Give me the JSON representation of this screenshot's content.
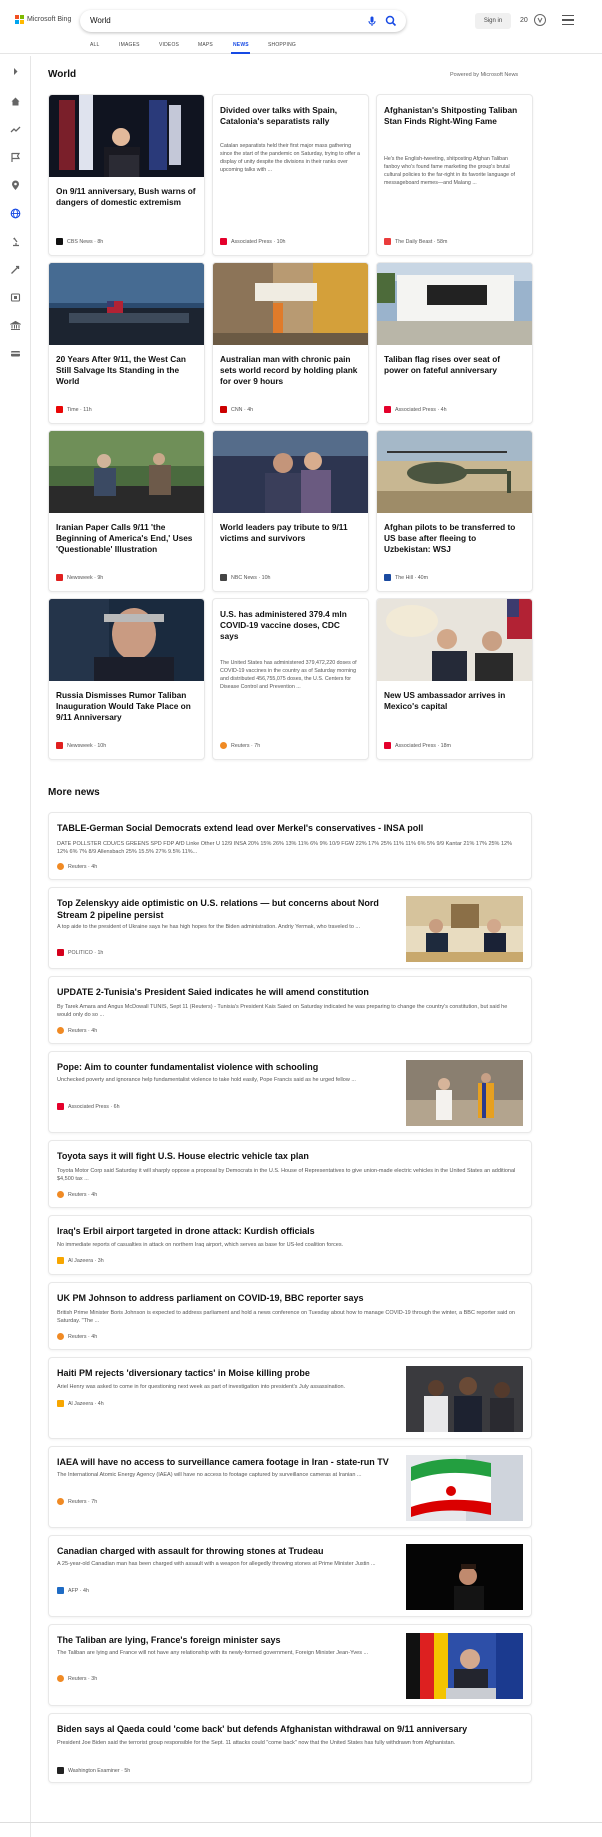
{
  "header": {
    "logo_text": "Microsoft Bing",
    "search_query": "World",
    "signin_label": "Sign in",
    "reward_points": "20"
  },
  "tabs": [
    {
      "label": "ALL"
    },
    {
      "label": "IMAGES"
    },
    {
      "label": "VIDEOS"
    },
    {
      "label": "MAPS"
    },
    {
      "label": "NEWS"
    },
    {
      "label": "SHOPPING"
    }
  ],
  "world": {
    "title": "World",
    "powered_by": "Powered by Microsoft News",
    "cards": [
      {
        "title": "On 9/11 anniversary, Bush warns of dangers of domestic extremism",
        "snippet": "",
        "source": "CBS News",
        "time": "8h",
        "favicon_color": "#111111"
      },
      {
        "title": "Divided over talks with Spain, Catalonia's separatists rally",
        "snippet": "Catalan separatists held their first major mass gathering since the start of the pandemic on Saturday, trying to offer a display of unity despite the divisions in their ranks over upcoming talks with ...",
        "source": "Associated Press",
        "time": "10h",
        "favicon_color": "#e4002b"
      },
      {
        "title": "Afghanistan's Shitposting Taliban Stan Finds Right-Wing Fame",
        "snippet": "He's the English-tweeting, shitposting Afghan Taliban fanboy who's found fame marketing the group's brutal cultural policies to the far-right in its favorite language of messageboard memes—and Malang ...",
        "source": "The Daily Beast",
        "time": "58m",
        "favicon_color": "#ea3c3c"
      },
      {
        "title": "20 Years After 9/11, the West Can Still Salvage Its Standing in the World",
        "snippet": "",
        "source": "Time",
        "time": "11h",
        "favicon_color": "#e90606"
      },
      {
        "title": "Australian man with chronic pain sets world record by holding plank for over 9 hours",
        "snippet": "",
        "source": "CNN",
        "time": "4h",
        "favicon_color": "#cc0000"
      },
      {
        "title": "Taliban flag rises over seat of power on fateful anniversary",
        "snippet": "",
        "source": "Associated Press",
        "time": "4h",
        "favicon_color": "#e4002b"
      },
      {
        "title": "Iranian Paper Calls 9/11 'the Beginning of America's End,' Uses 'Questionable' Illustration",
        "snippet": "",
        "source": "Newsweek",
        "time": "9h",
        "favicon_color": "#e0201f"
      },
      {
        "title": "World leaders pay tribute to 9/11 victims and survivors",
        "snippet": "",
        "source": "NBC News",
        "time": "10h",
        "favicon_color": "#444444"
      },
      {
        "title": "Afghan pilots to be transferred to US base after fleeing to Uzbekistan: WSJ",
        "snippet": "",
        "source": "The Hill",
        "time": "40m",
        "favicon_color": "#1a4aa0"
      },
      {
        "title": "Russia Dismisses Rumor Taliban Inauguration Would Take Place on 9/11 Anniversary",
        "snippet": "",
        "source": "Newsweek",
        "time": "10h",
        "favicon_color": "#e0201f"
      },
      {
        "title": "U.S. has administered 379.4 mln COVID-19 vaccine doses, CDC says",
        "snippet": "The United States has administered 379,472,220 doses of COVID-19 vaccines in the country as of Saturday morning and distributed 456,755,075 doses, the U.S. Centers for Disease Control and Prevention ...",
        "source": "Reuters",
        "time": "7h",
        "favicon_color": "#f08a24"
      },
      {
        "title": "New US ambassador arrives in Mexico's capital",
        "snippet": "",
        "source": "Associated Press",
        "time": "18m",
        "favicon_color": "#e4002b"
      }
    ]
  },
  "more_news": {
    "title": "More news",
    "items": [
      {
        "title": "TABLE-German Social Democrats extend lead over Merkel's conservatives - INSA poll",
        "snippet": "DATE POLLSTER CDU/CS GREENS SPD FDP AfD Linke Other U 12/9 INSA 20% 15% 26% 13% 11% 6% 9% 10/9 FGW 22% 17% 25% 11% 11% 6% 5% 9/9 Kantar 21% 17% 25% 12% 12% 6% 7% 8/9 Allensbach 25% 15.5% 27% 9.5% 11%...",
        "source": "Reuters",
        "time": "4h",
        "favicon_color": "#f08a24"
      },
      {
        "title": "Top Zelenskyy aide optimistic on U.S. relations — but concerns about Nord Stream 2 pipeline persist",
        "snippet": "A top aide to the president of Ukraine says he has high hopes for the Biden administration. Andriy Yermak, who traveled to ...",
        "source": "POLITICO",
        "time": "1h",
        "favicon_color": "#d5001c"
      },
      {
        "title": "UPDATE 2-Tunisia's President Saied indicates he will amend constitution",
        "snippet": "By Tarek Amara and Angus McDowall TUNIS, Sept 11 (Reuters) - Tunisia's President Kais Saied on Saturday indicated he was preparing to change the country's constitution, but said he would only do so ...",
        "source": "Reuters",
        "time": "4h",
        "favicon_color": "#f08a24"
      },
      {
        "title": "Pope: Aim to counter fundamentalist violence with schooling",
        "snippet": "Unchecked poverty and ignorance help fundamentalist violence to take hold easily, Pope Francis said as he urged fellow ...",
        "source": "Associated Press",
        "time": "6h",
        "favicon_color": "#e4002b"
      },
      {
        "title": "Toyota says it will fight U.S. House electric vehicle tax plan",
        "snippet": "Toyota Motor Corp said Saturday it will sharply oppose a proposal by Democrats in the U.S. House of Representatives to give union-made electric vehicles in the United States an additional $4,500 tax ...",
        "source": "Reuters",
        "time": "4h",
        "favicon_color": "#f08a24"
      },
      {
        "title": "Iraq's Erbil airport targeted in drone attack: Kurdish officials",
        "snippet": "No immediate reports of casualties in attack on northern Iraq airport, which serves as base for US-led coalition forces.",
        "source": "Al Jazeera",
        "time": "3h",
        "favicon_color": "#f7a600"
      },
      {
        "title": "UK PM Johnson to address parliament on COVID-19, BBC reporter says",
        "snippet": "British Prime Minister Boris Johnson is expected to address parliament and hold a news conference on Tuesday about how to manage COVID-19 through the winter, a BBC reporter said on Saturday. \"The ...",
        "source": "Reuters",
        "time": "4h",
        "favicon_color": "#f08a24"
      },
      {
        "title": "Haiti PM rejects 'diversionary tactics' in Moise killing probe",
        "snippet": "Ariel Henry was asked to come in for questioning next week as part of investigation into president's July assassination.",
        "source": "Al Jazeera",
        "time": "4h",
        "favicon_color": "#f7a600"
      },
      {
        "title": "IAEA will have no access to surveillance camera footage in Iran - state-run TV",
        "snippet": "The International Atomic Energy Agency (IAEA) will have no access to footage captured by surveillance cameras at Iranian ...",
        "source": "Reuters",
        "time": "7h",
        "favicon_color": "#f08a24"
      },
      {
        "title": "Canadian charged with assault for throwing stones at Trudeau",
        "snippet": "A 25-year-old Canadian man has been charged with assault with a weapon for allegedly throwing stones at Prime Minister Justin ...",
        "source": "AFP",
        "time": "4h",
        "favicon_color": "#1e6bc4"
      },
      {
        "title": "The Taliban are lying, France's foreign minister says",
        "snippet": "The Taliban are lying and France will not have any relationship with its newly-formed government, Foreign Minister Jean-Yves ...",
        "source": "Reuters",
        "time": "3h",
        "favicon_color": "#f08a24"
      },
      {
        "title": "Biden says al Qaeda could 'come back' but defends Afghanistan withdrawal on 9/11 anniversary",
        "snippet": "President Joe Biden said the terrorist group responsible for the Sept. 11 attacks could \"come back\" now that the United States has fully withdrawn from Afghanistan.",
        "source": "Washington Examiner",
        "time": "5h",
        "favicon_color": "#222222"
      }
    ]
  },
  "colors": {
    "accent": "#174ae4",
    "text": "#111111",
    "muted": "#555555"
  }
}
